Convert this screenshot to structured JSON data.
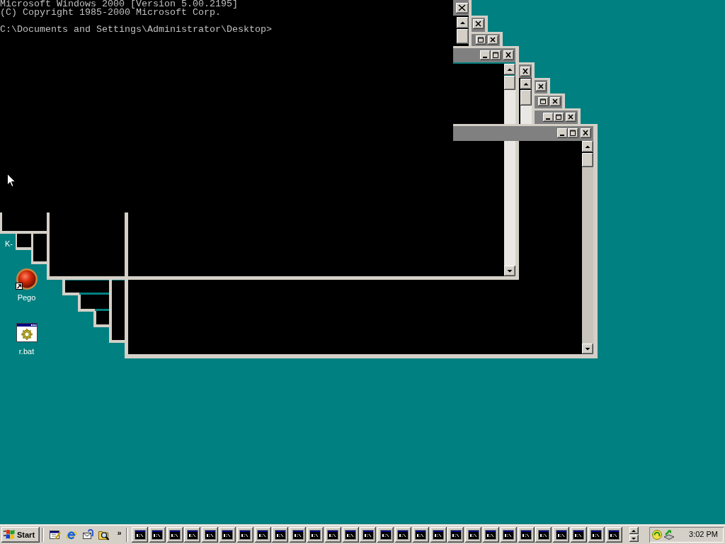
{
  "console": {
    "banner": [
      "Microsoft Windows 2000 [Version 5.00.2195]",
      "(C) Copyright 1985-2000 Microsoft Corp."
    ],
    "prompt": "C:\\Documents and Settings\\Administrator\\Desktop>"
  },
  "windows": [
    {
      "active": false
    },
    {
      "active": false
    }
  ],
  "desktop_icons": [
    {
      "label": "K-",
      "kind": "covered"
    },
    {
      "label": "Pego",
      "kind": "shortcut"
    },
    {
      "label": "r.bat",
      "kind": "batch"
    }
  ],
  "taskbar": {
    "start": "Start",
    "quick_launch_more": "»",
    "tasks": [
      {
        "selected": false
      },
      {
        "selected": false
      },
      {
        "selected": false
      },
      {
        "selected": false
      },
      {
        "selected": false
      },
      {
        "selected": false
      },
      {
        "selected": false
      },
      {
        "selected": false
      },
      {
        "selected": false
      },
      {
        "selected": false
      },
      {
        "selected": false
      },
      {
        "selected": false
      },
      {
        "selected": false
      },
      {
        "selected": false
      },
      {
        "selected": false
      },
      {
        "selected": false
      },
      {
        "selected": false
      },
      {
        "selected": false
      },
      {
        "selected": false
      },
      {
        "selected": false
      },
      {
        "selected": false
      },
      {
        "selected": false
      },
      {
        "selected": false
      },
      {
        "selected": false
      },
      {
        "selected": false
      },
      {
        "selected": false
      },
      {
        "selected": false
      },
      {
        "selected": false
      }
    ],
    "clock": "3:02 PM"
  }
}
